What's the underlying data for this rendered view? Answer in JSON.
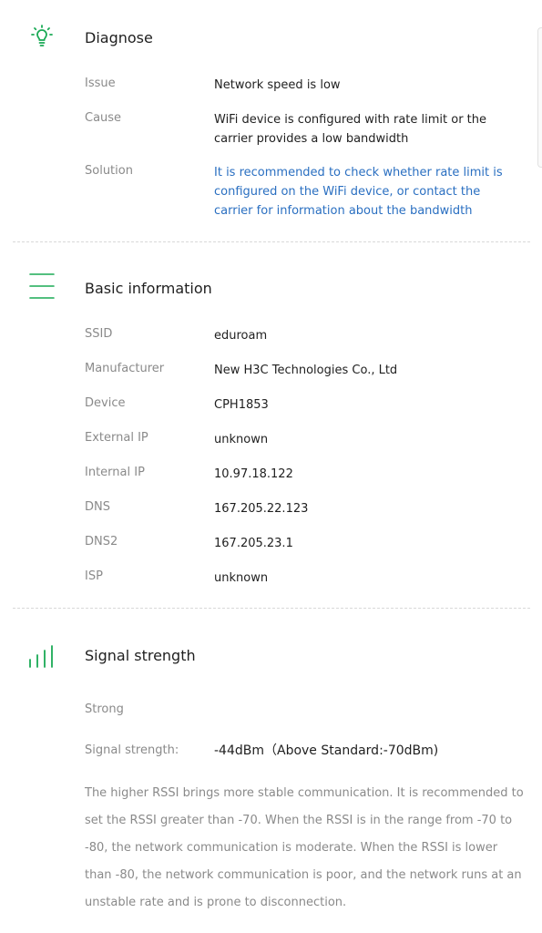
{
  "diagnose": {
    "icon": "lightbulb-icon",
    "title": "Diagnose",
    "issue_label": "Issue",
    "issue_value": "Network speed is low",
    "cause_label": "Cause",
    "cause_value": "WiFi device is configured with rate limit or the carrier provides a low bandwidth",
    "solution_label": "Solution",
    "solution_value": "It is recommended to check whether rate limit is configured on the WiFi device, or contact the carrier for information about the bandwidth"
  },
  "basic": {
    "icon": "menu-lines-icon",
    "title": "Basic information",
    "rows": [
      {
        "label": "SSID",
        "value": "eduroam"
      },
      {
        "label": "Manufacturer",
        "value": "New H3C Technologies Co., Ltd"
      },
      {
        "label": "Device",
        "value": "CPH1853"
      },
      {
        "label": "External IP",
        "value": "unknown"
      },
      {
        "label": "Internal IP",
        "value": "10.97.18.122"
      },
      {
        "label": "DNS",
        "value": "167.205.22.123"
      },
      {
        "label": "DNS2",
        "value": "167.205.23.1"
      },
      {
        "label": "ISP",
        "value": "unknown"
      }
    ]
  },
  "signal": {
    "icon": "signal-bars-icon",
    "title": "Signal strength",
    "level": "Strong",
    "strength_label": "Signal strength:",
    "strength_value": "-44dBm（Above Standard:-70dBm)",
    "description": "The higher RSSI brings more stable communication. It is recommended to set the RSSI greater than -70. When the RSSI is in the range from -70 to -80, the network communication is moderate. When the RSSI is lower than -80, the network communication is poor, and the network runs at an unstable rate and is prone to disconnection."
  },
  "colors": {
    "accent": "#1aaa55",
    "link": "#2a6fc1",
    "label": "#8a8a8a"
  }
}
